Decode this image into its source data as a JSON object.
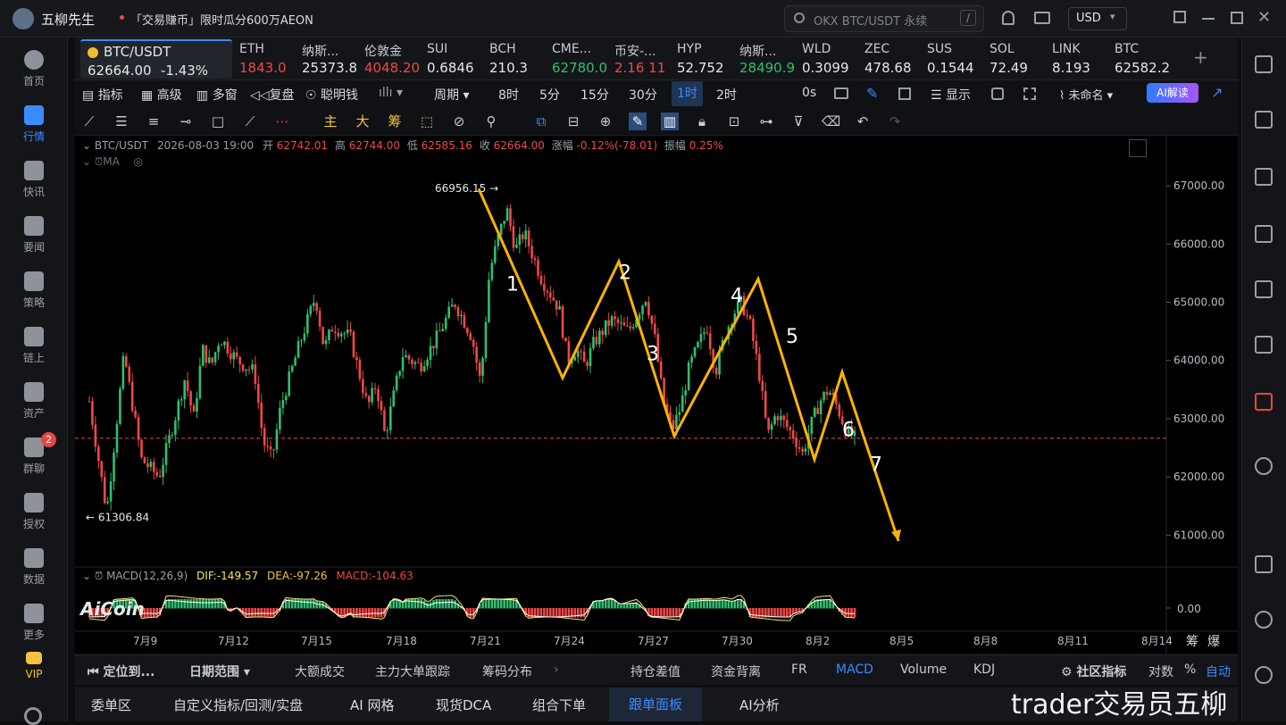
{
  "app": {
    "title": "五柳先生",
    "promo": "「交易赚币」限时瓜分600万AEON",
    "search_placeholder": "OKX BTC/USDT 永续",
    "search_shortcut": "/",
    "currency": "USD"
  },
  "nav": [
    {
      "label": "首页"
    },
    {
      "label": "行情"
    },
    {
      "label": "快讯"
    },
    {
      "label": "要闻"
    },
    {
      "label": "策略"
    },
    {
      "label": "链上"
    },
    {
      "label": "资产"
    },
    {
      "label": "群聊",
      "badge": "2"
    },
    {
      "label": "授权"
    },
    {
      "label": "数据"
    },
    {
      "label": "更多"
    },
    {
      "label": "VIP"
    }
  ],
  "active_ticker": {
    "name": "BTC/USDT",
    "price": "62664.00",
    "change": "-1.43%"
  },
  "tickers": [
    {
      "name": "ETH",
      "price": "1843.0",
      "dir": "down"
    },
    {
      "name": "纳斯...",
      "price": "25373.8",
      "dir": "neu"
    },
    {
      "name": "伦敦金",
      "price": "4048.20",
      "dir": "down"
    },
    {
      "name": "SUI",
      "price": "0.6846",
      "dir": "neu"
    },
    {
      "name": "BCH",
      "price": "210.3",
      "dir": "neu"
    },
    {
      "name": "CME...",
      "price": "62780.0",
      "dir": "up"
    },
    {
      "name": "币安-...",
      "price": "2.16 11",
      "dir": "down"
    },
    {
      "name": "HYP",
      "price": "52.752",
      "dir": "neu"
    },
    {
      "name": "纳斯...",
      "price": "28490.9",
      "dir": "up"
    },
    {
      "name": "WLD",
      "price": "0.3099",
      "dir": "neu"
    },
    {
      "name": "ZEC",
      "price": "478.68",
      "dir": "neu"
    },
    {
      "name": "SUS",
      "price": "0.1544",
      "dir": "neu"
    },
    {
      "name": "SOL",
      "price": "72.49",
      "dir": "neu"
    },
    {
      "name": "LINK",
      "price": "8.193",
      "dir": "neu"
    },
    {
      "name": "BTC",
      "price": "62582.2",
      "dir": "neu"
    }
  ],
  "toolbar": {
    "indicator": "指标",
    "advanced": "高级",
    "multi": "多窗",
    "replay": "复盘",
    "smart": "聪明钱",
    "period": "周期",
    "periods": [
      "8时",
      "5分",
      "15分",
      "30分",
      "1时",
      "2时"
    ],
    "selected_period": "1时",
    "countdown": "0s",
    "display": "显示",
    "layout_name": "未命名",
    "ai_read": "AI解读"
  },
  "drawbar": {
    "main": "主",
    "big": "大",
    "chips": "筹"
  },
  "chart_header": {
    "symbol": "BTC/USDT",
    "time": "2026-08-03 19:00",
    "open_label": "开",
    "open": "62742.01",
    "high_label": "高",
    "high": "62744.00",
    "low_label": "低",
    "low": "62585.16",
    "close_label": "收",
    "close": "62664.00",
    "chg_label": "涨幅",
    "chg": "-0.12%(-78.01)",
    "amp_label": "振幅",
    "amp": "0.25%",
    "ma": "MA"
  },
  "macd_header": {
    "name": "MACD(12,26,9)",
    "dif": "DIF:-149.57",
    "dea": "DEA:-97.26",
    "macd": "MACD:-104.63"
  },
  "watermark": "AiCoin",
  "corner_labels": {
    "a": "筹",
    "b": "爆"
  },
  "colors": {
    "up": "#2fbf71",
    "down": "#f04848",
    "accent": "#3a8bff",
    "wave": "#ffb300",
    "macd_dif": "#f5e663",
    "macd_dea": "#ffffff"
  },
  "chart_data": {
    "type": "candlestick",
    "interval": "1h",
    "x_ticks": [
      "7月9",
      "7月12",
      "7月15",
      "7月18",
      "7月21",
      "7月24",
      "7月27",
      "7月30",
      "8月2",
      "8月5",
      "8月8",
      "8月11",
      "8月14"
    ],
    "y_ticks": [
      "67000.00",
      "66000.00",
      "65000.00",
      "64000.00",
      "63000.00",
      "62000.00",
      "61000.00"
    ],
    "ylim": [
      60500,
      67400
    ],
    "high_mark": "66956.15",
    "low_mark": "61306.84",
    "last_price": 62664.0,
    "close_path": [
      [
        0,
        63300
      ],
      [
        2,
        61400
      ],
      [
        4,
        64100
      ],
      [
        6,
        62300
      ],
      [
        8,
        62000
      ],
      [
        10,
        63100
      ],
      [
        11,
        63700
      ],
      [
        12,
        63000
      ],
      [
        13,
        64200
      ],
      [
        14,
        63900
      ],
      [
        15,
        64400
      ],
      [
        17,
        64000
      ],
      [
        19,
        63800
      ],
      [
        20,
        62600
      ],
      [
        21,
        62300
      ],
      [
        22,
        63200
      ],
      [
        24,
        64200
      ],
      [
        26,
        65100
      ],
      [
        27,
        64200
      ],
      [
        28,
        64600
      ],
      [
        30,
        64400
      ],
      [
        32,
        63200
      ],
      [
        33,
        63600
      ],
      [
        34,
        62700
      ],
      [
        36,
        64100
      ],
      [
        38,
        63900
      ],
      [
        40,
        64400
      ],
      [
        42,
        65000
      ],
      [
        44,
        64400
      ],
      [
        45,
        63600
      ],
      [
        46,
        65500
      ],
      [
        47,
        66100
      ],
      [
        48,
        66600
      ],
      [
        49,
        65900
      ],
      [
        50,
        66200
      ],
      [
        52,
        65400
      ],
      [
        54,
        64900
      ],
      [
        55,
        64000
      ],
      [
        56,
        64200
      ],
      [
        57,
        63900
      ],
      [
        58,
        64300
      ],
      [
        60,
        64700
      ],
      [
        62,
        64500
      ],
      [
        64,
        65100
      ],
      [
        65,
        64400
      ],
      [
        66,
        63300
      ],
      [
        67,
        62800
      ],
      [
        68,
        63200
      ],
      [
        69,
        63900
      ],
      [
        71,
        64600
      ],
      [
        72,
        63800
      ],
      [
        73,
        64400
      ],
      [
        74,
        64800
      ],
      [
        75,
        65000
      ],
      [
        76,
        64600
      ],
      [
        77,
        63800
      ],
      [
        78,
        62700
      ],
      [
        79,
        63100
      ],
      [
        80,
        62900
      ],
      [
        81,
        62700
      ],
      [
        82,
        62400
      ],
      [
        83,
        62900
      ],
      [
        84,
        63300
      ],
      [
        85,
        63500
      ],
      [
        86,
        63200
      ],
      [
        87,
        62800
      ],
      [
        88,
        62664
      ]
    ],
    "ma_series": [
      {
        "name": "MA",
        "visible": false
      }
    ],
    "macd_zero": "0.00",
    "annotations": [
      {
        "label": "1",
        "x": "7月22",
        "y": 65200
      },
      {
        "label": "2",
        "x": "7月26",
        "y": 65400
      },
      {
        "label": "3",
        "x": "7月27",
        "y": 64000
      },
      {
        "label": "4",
        "x": "7月30",
        "y": 65000
      },
      {
        "label": "5",
        "x": "8月1",
        "y": 64300
      },
      {
        "label": "6",
        "x": "8月3",
        "y": 62700
      },
      {
        "label": "7",
        "x": "8月4",
        "y": 62100
      }
    ],
    "wave_path": [
      {
        "x": "7月21",
        "y": 66950
      },
      {
        "x": "7月24",
        "y": 63700
      },
      {
        "x": "7月26",
        "y": 65700
      },
      {
        "x": "7月28",
        "y": 62700
      },
      {
        "x": "7月31",
        "y": 65400
      },
      {
        "x": "8月2",
        "y": 62300
      },
      {
        "x": "8月3",
        "y": 63800
      },
      {
        "x": "8月5",
        "y": 60900
      }
    ]
  },
  "bottom_tabs": {
    "locate": "定位到...",
    "date_range": "日期范围",
    "items": [
      "大额成交",
      "主力大单跟踪",
      "筹码分布",
      "持仓差值",
      "资金背离",
      "FR",
      "MACD",
      "Volume",
      "KDJ"
    ],
    "selected": "MACD",
    "community": "社区指标",
    "log": "对数",
    "pct": "%",
    "auto": "自动"
  },
  "bottom_bar": {
    "items": [
      "委单区",
      "自定义指标/回测/实盘",
      "AI 网格",
      "现货DCA",
      "组合下单",
      "跟单面板",
      "AI分析"
    ],
    "selected": "跟单面板"
  },
  "watermark_text": "trader交易员五柳"
}
